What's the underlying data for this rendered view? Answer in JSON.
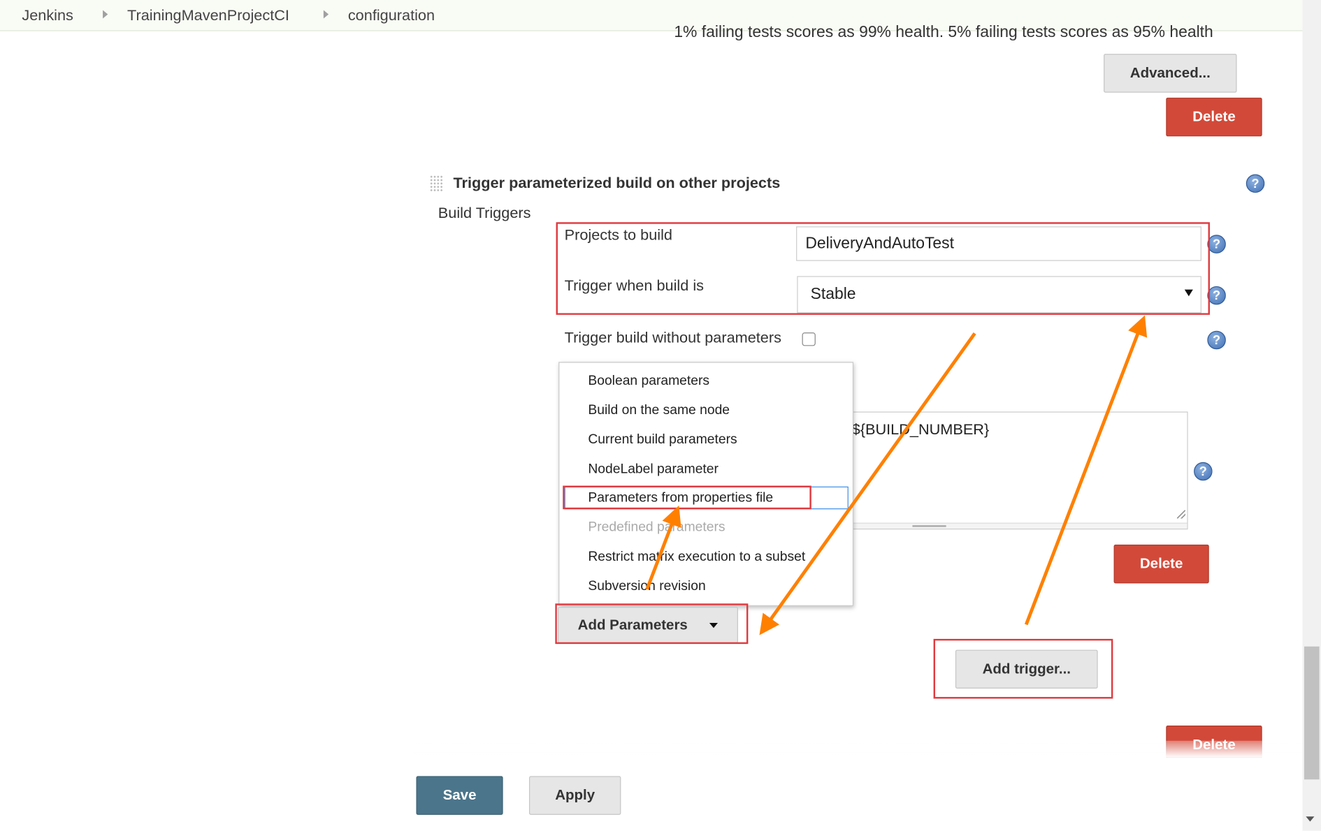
{
  "breadcrumb": {
    "items": [
      "Jenkins",
      "TrainingMavenProjectCI",
      "configuration"
    ]
  },
  "partial_text": {
    "health": "1% failing tests scores as 99% health. 5% failing tests scores as 95% health"
  },
  "buttons": {
    "advanced": "Advanced...",
    "delete": "Delete",
    "add_parameters": "Add Parameters",
    "add_trigger": "Add trigger...",
    "save": "Save",
    "apply": "Apply"
  },
  "section": {
    "title": "Trigger parameterized build on other projects",
    "build_triggers": "Build Triggers"
  },
  "form": {
    "projects_label": "Projects to build",
    "projects_value": "DeliveryAndAutoTest",
    "trigger_when_label": "Trigger when build is",
    "trigger_when_value": "Stable",
    "without_params_label": "Trigger build without parameters",
    "textarea_value": "${BUILD_NUMBER}"
  },
  "menu": {
    "items": [
      "Boolean parameters",
      "Build on the same node",
      "Current build parameters",
      "NodeLabel parameter",
      "Parameters from properties file",
      "Predefined parameters",
      "Restrict matrix execution to a subset",
      "Subversion revision"
    ]
  },
  "icons": {
    "help": "?"
  },
  "colors": {
    "delete_red": "#d24939",
    "save_blue": "#4b758b",
    "annotation_orange": "#ff8000",
    "highlight_red": "#e0393e"
  }
}
